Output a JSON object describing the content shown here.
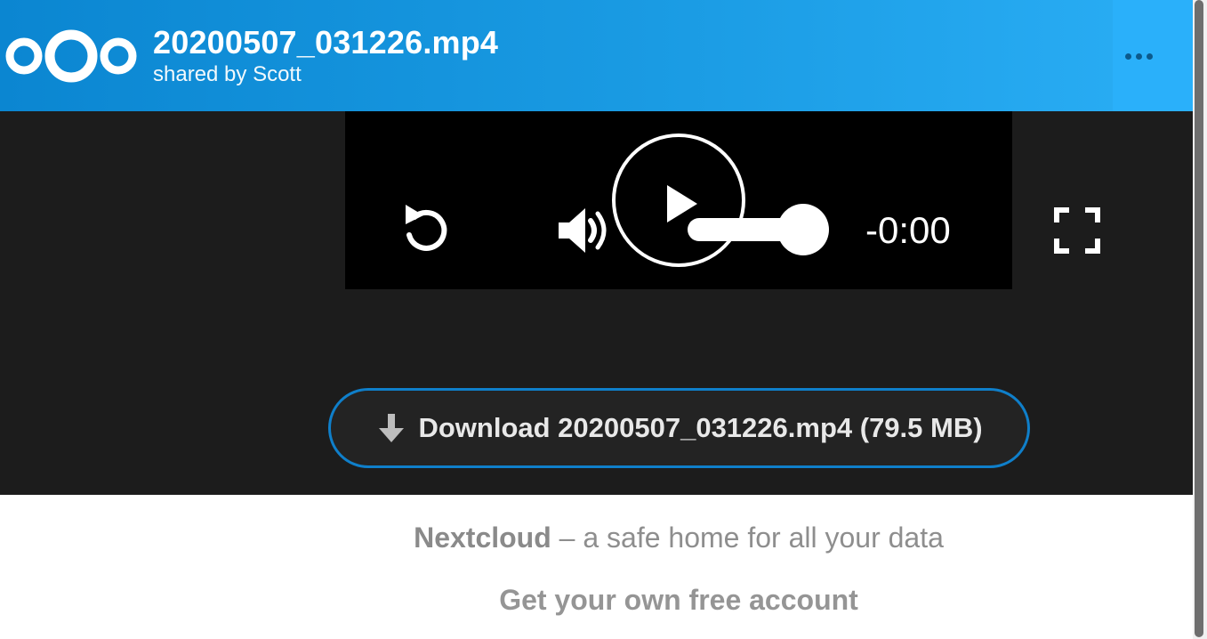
{
  "header": {
    "file_title": "20200507_031226.mp4",
    "shared_by": "shared by Scott",
    "logo_icon": "nextcloud-logo",
    "menu_icon": "more-horizontal-icon"
  },
  "player": {
    "replay_icon": "replay-icon",
    "volume_icon": "volume-icon",
    "play_icon": "play-icon",
    "fullscreen_icon": "fullscreen-icon",
    "volume_level": 1.0,
    "time_remaining": "-0:00"
  },
  "download": {
    "icon": "download-arrow-icon",
    "label": "Download 20200507_031226.mp4 (79.5 MB)"
  },
  "footer": {
    "brand": "Nextcloud",
    "tagline_rest": " – a safe home for all your data",
    "signup_link": "Get your own free account"
  },
  "colors": {
    "header_start": "#0b86d1",
    "header_end": "#2aaef5",
    "content_bg": "#1c1c1c",
    "player_bg": "#000000",
    "download_border": "#0f7fca",
    "footer_text": "#8e8e8e"
  }
}
